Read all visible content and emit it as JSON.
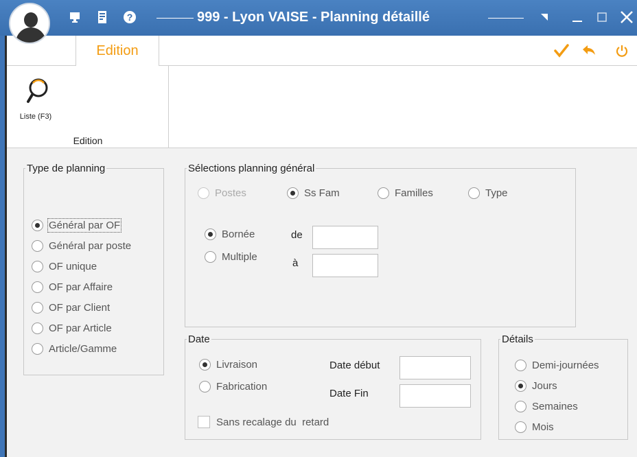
{
  "window": {
    "title": "999 - Lyon VAISE - Planning détaillé",
    "icons": [
      "monitor-icon",
      "document-icon",
      "help-icon"
    ]
  },
  "ribbon": {
    "tab": "Edition",
    "actions": [
      "checkmark-icon",
      "undo-icon",
      "power-icon"
    ],
    "group": {
      "label": "Edition",
      "buttons": [
        {
          "label": "Liste (F3)",
          "icon": "search-icon"
        }
      ]
    }
  },
  "type_planning": {
    "legend": "Type de planning",
    "options": [
      {
        "label": "Général par OF",
        "selected": true
      },
      {
        "label": "Général par poste",
        "selected": false
      },
      {
        "label": "OF unique",
        "selected": false
      },
      {
        "label": "OF par Affaire",
        "selected": false
      },
      {
        "label": "OF par Client",
        "selected": false
      },
      {
        "label": "OF par Article",
        "selected": false
      },
      {
        "label": "Article/Gamme",
        "selected": false
      }
    ]
  },
  "selections": {
    "legend": "Sélections planning général",
    "level_options": [
      {
        "label": "Postes",
        "selected": false,
        "disabled": true
      },
      {
        "label": "Ss Fam",
        "selected": true,
        "disabled": false
      },
      {
        "label": "Familles",
        "selected": false,
        "disabled": false
      },
      {
        "label": "Type",
        "selected": false,
        "disabled": false
      }
    ],
    "mode_options": [
      {
        "label": "Bornée",
        "selected": true
      },
      {
        "label": "Multiple",
        "selected": false
      }
    ],
    "from_label": "de",
    "from_value": "",
    "to_label": "à",
    "to_value": ""
  },
  "date": {
    "legend": "Date",
    "options": [
      {
        "label": "Livraison",
        "selected": true
      },
      {
        "label": "Fabrication",
        "selected": false
      }
    ],
    "start_label": "Date début",
    "start_value": "",
    "end_label": "Date Fin",
    "end_value": "",
    "checkbox_label": "Sans recalage du  retard",
    "checkbox_checked": false
  },
  "details": {
    "legend": "Détails",
    "options": [
      {
        "label": "Demi-journées",
        "selected": false
      },
      {
        "label": "Jours",
        "selected": true
      },
      {
        "label": "Semaines",
        "selected": false
      },
      {
        "label": "Mois",
        "selected": false
      }
    ]
  },
  "colors": {
    "titlebar": "#3a70b0",
    "accent": "#f39c12",
    "panel_bg": "#f2f2f2"
  }
}
